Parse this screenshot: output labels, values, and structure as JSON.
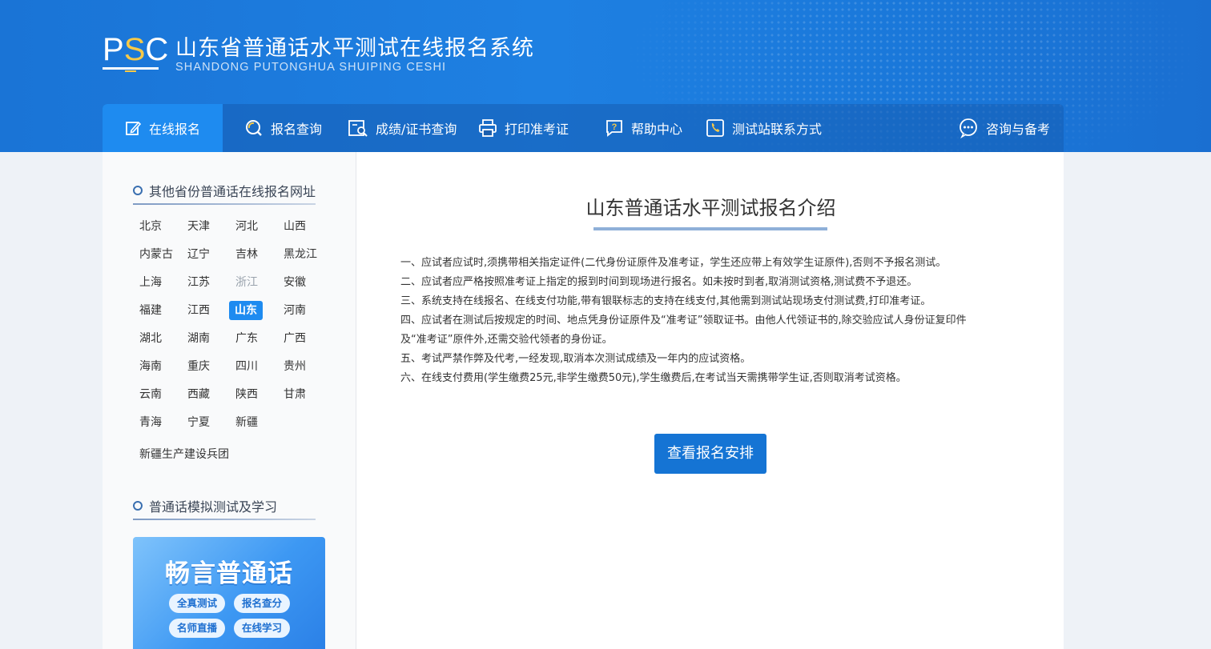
{
  "header": {
    "logo": "PSC",
    "title": "山东省普通话水平测试在线报名系统",
    "subtitle": "SHANDONG PUTONGHUA SHUIPING CESHI"
  },
  "nav": {
    "items": [
      {
        "label": "在线报名",
        "icon": "edit-icon",
        "active": true
      },
      {
        "label": "报名查询",
        "icon": "search-icon"
      },
      {
        "label": "成绩/证书查询",
        "icon": "search-doc-icon"
      },
      {
        "label": "打印准考证",
        "icon": "printer-icon"
      },
      {
        "label": "帮助中心",
        "icon": "help-icon"
      },
      {
        "label": "测试站联系方式",
        "icon": "phone-icon"
      },
      {
        "label": "咨询与备考",
        "icon": "chat-icon"
      }
    ]
  },
  "sidebar": {
    "section1_title": "其他省份普通话在线报名网址",
    "provinces": [
      "北京",
      "天津",
      "河北",
      "山西",
      "内蒙古",
      "辽宁",
      "吉林",
      "黑龙江",
      "上海",
      "江苏",
      "浙江",
      "安徽",
      "福建",
      "江西",
      "山东",
      "河南",
      "湖北",
      "湖南",
      "广东",
      "广西",
      "海南",
      "重庆",
      "四川",
      "贵州",
      "云南",
      "西藏",
      "陕西",
      "甘肃",
      "青海",
      "宁夏",
      "新疆"
    ],
    "selected_province": "山东",
    "dimmed_province": "浙江",
    "extra": "新疆生产建设兵团",
    "section2_title": "普通话模拟测试及学习",
    "promo": {
      "title": "畅言普通话",
      "tags": [
        "全真测试",
        "报名查分",
        "名师直播",
        "在线学习"
      ]
    }
  },
  "main": {
    "title": "山东普通话水平测试报名介绍",
    "rules": [
      "一、应试者应试时,须携带相关指定证件(二代身份证原件及准考证，学生还应带上有效学生证原件),否则不予报名测试。",
      "二、应试者应严格按照准考证上指定的报到时间到现场进行报名。如未按时到者,取消测试资格,测试费不予退还。",
      "三、系统支持在线报名、在线支付功能,带有银联标志的支持在线支付,其他需到测试站现场支付测试费,打印准考证。",
      "四、应试者在测试后按规定的时间、地点凭身份证原件及“准考证”领取证书。由他人代领证书的,除交验应试人身份证复印件",
      "及“准考证”原件外,还需交验代领者的身份证。",
      "五、考试严禁作弊及代考,一经发现,取消本次测试成绩及一年内的应试资格。",
      "六、在线支付费用(学生缴费25元,非学生缴费50元),学生缴费后,在考试当天需携带学生证,否则取消考试资格。"
    ],
    "button_label": "查看报名安排"
  },
  "colors": {
    "header_blue": "#1e80e2",
    "active_tab": "#1e8bf0",
    "button_blue": "#1574d4",
    "logo_accent": "#f7c948"
  }
}
